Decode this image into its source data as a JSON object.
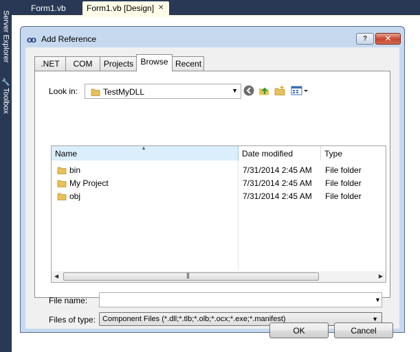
{
  "ide": {
    "left_tabs": [
      "Server Explorer",
      "Toolbox"
    ],
    "document_tabs": [
      {
        "label": "Form1.vb",
        "active": false
      },
      {
        "label": "Form1.vb [Design]",
        "active": true
      }
    ]
  },
  "dialog": {
    "title": "Add Reference",
    "help_label": "?",
    "close_label": "✕",
    "tabs": [
      {
        "label": ".NET",
        "active": false
      },
      {
        "label": "COM",
        "active": false
      },
      {
        "label": "Projects",
        "active": false
      },
      {
        "label": "Browse",
        "active": true
      },
      {
        "label": "Recent",
        "active": false
      }
    ],
    "look_in": {
      "label": "Look in:",
      "value": "TestMyDLL"
    },
    "columns": {
      "name": "Name",
      "date": "Date modified",
      "type": "Type"
    },
    "files": [
      {
        "name": "bin",
        "date": "7/31/2014 2:45 AM",
        "type": "File folder"
      },
      {
        "name": "My Project",
        "date": "7/31/2014 2:45 AM",
        "type": "File folder"
      },
      {
        "name": "obj",
        "date": "7/31/2014 2:45 AM",
        "type": "File folder"
      }
    ],
    "file_name": {
      "label": "File name:",
      "value": ""
    },
    "files_of_type": {
      "label": "Files of type:",
      "value": "Component Files (*.dll;*.tlb;*.olb;*.ocx;*.exe;*.manifest)"
    },
    "buttons": {
      "ok": "OK",
      "cancel": "Cancel"
    }
  },
  "colors": {
    "ide_chrome": "#293955",
    "dialog_frame": "#c6d9ef",
    "close_button": "#c7452c",
    "folder": "#e8c15a"
  },
  "icons": [
    "reference-icon",
    "back-icon",
    "up-folder-icon",
    "new-folder-icon",
    "view-menu-icon",
    "folder-icon",
    "sort-arrow-icon"
  ]
}
